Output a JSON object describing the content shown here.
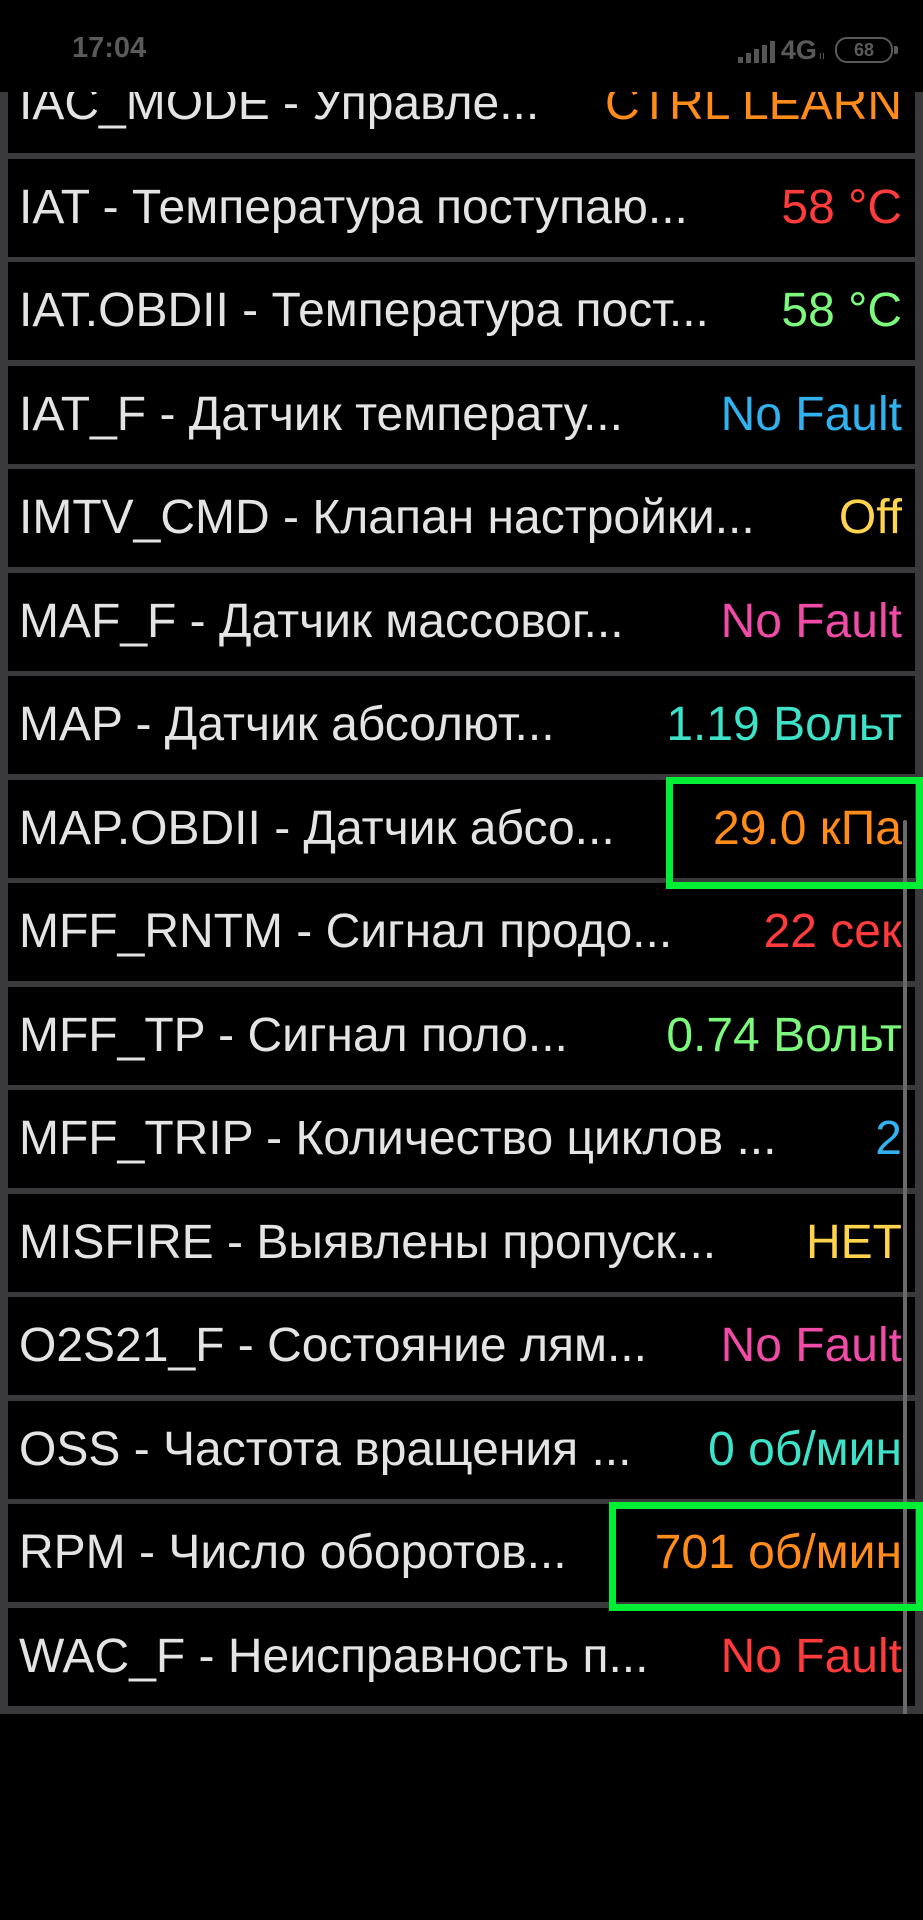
{
  "status_bar": {
    "time": "17:04",
    "network": "4G",
    "network_sub": "ıı",
    "battery": "68",
    "icons": [
      "signal-icon",
      "battery-icon"
    ]
  },
  "rows": [
    {
      "label": "IAC_MODE - Управле...",
      "value": "CTRL LEARN",
      "color": "#ff8c1a"
    },
    {
      "label": "IAT - Температура поступаю...",
      "value": "58 °C",
      "color": "#ff3b3b"
    },
    {
      "label": "IAT.OBDII - Температура пост...",
      "value": "58 °C",
      "color": "#7cf87c"
    },
    {
      "label": "IAT_F - Датчик температу...",
      "value": "No Fault",
      "color": "#31b2ef"
    },
    {
      "label": "IMTV_CMD - Клапан настройки...",
      "value": "Off",
      "color": "#ffd34d"
    },
    {
      "label": "MAF_F - Датчик массовог...",
      "value": "No Fault",
      "color": "#f04ba7"
    },
    {
      "label": "MAP - Датчик абсолют...",
      "value": "1.19 Вольт",
      "color": "#3de2c8"
    },
    {
      "label": "MAP.OBDII - Датчик абсо...",
      "value": "29.0 кПа",
      "color": "#ff8c1a"
    },
    {
      "label": "MFF_RNTM - Сигнал продо...",
      "value": "22 сек",
      "color": "#ff3b3b"
    },
    {
      "label": "MFF_TP - Сигнал поло...",
      "value": "0.74 Вольт",
      "color": "#7cf87c"
    },
    {
      "label": "MFF_TRIP - Количество циклов ...",
      "value": "2",
      "color": "#31b2ef"
    },
    {
      "label": "MISFIRE - Выявлены пропуск...",
      "value": "НЕТ",
      "color": "#ffd34d"
    },
    {
      "label": "O2S21_F - Состояние лям...",
      "value": "No Fault",
      "color": "#f04ba7"
    },
    {
      "label": "OSS - Частота вращения ...",
      "value": "0 об/мин",
      "color": "#3de2c8"
    },
    {
      "label": "RPM - Число оборотов...",
      "value": "701 об/мин",
      "color": "#ff8c1a"
    },
    {
      "label": "WAC_F - Неисправность п...",
      "value": "No Fault",
      "color": "#ff3b3b"
    }
  ],
  "highlight_color": "#00ee33"
}
